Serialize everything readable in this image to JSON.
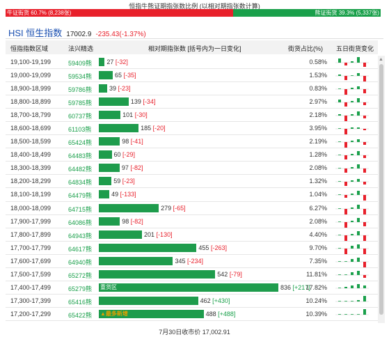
{
  "title": "恒指牛熊证期指张数比例 (以相对期指张数计算)",
  "ratio": {
    "bull_label": "牛证街货 60.7% (8,238张)",
    "bear_label": "熊证街货 39.3% (5,337张)",
    "bull_fraction": 0.607,
    "bull_color": "#e8202b",
    "bear_color": "#1aa04b"
  },
  "hsi": {
    "name": "HSI 恒生指数",
    "value": "17002.9",
    "change": "-235.43(-1.37%)"
  },
  "headers": {
    "range": "恒指指数区域",
    "code": "法兴精选",
    "relative": "相对期指张数 [括号内为一日变化]",
    "pct": "街货占比(%)",
    "five_day": "五日街货变化"
  },
  "colors": {
    "bar": "#1e9c4c",
    "up": "#1aa04b",
    "down": "#e8202b"
  },
  "rows": [
    {
      "range": "19,100-19,199",
      "code": "59409熊",
      "count": "27",
      "delta": "[-32]",
      "pct": "0.58%",
      "bar_value": 27,
      "spark": [
        3,
        -2,
        1,
        4,
        -3
      ]
    },
    {
      "range": "19,000-19,099",
      "code": "59534熊",
      "count": "65",
      "delta": "[-35]",
      "pct": "1.53%",
      "bar_value": 65,
      "spark": [
        1,
        -3,
        0,
        2,
        -4
      ]
    },
    {
      "range": "18,900-18,999",
      "code": "59786熊",
      "count": "39",
      "delta": "[-23]",
      "pct": "0.83%",
      "bar_value": 39,
      "spark": [
        0,
        -4,
        1,
        2,
        -3
      ]
    },
    {
      "range": "18,800-18,899",
      "code": "59785熊",
      "count": "139",
      "delta": "[-34]",
      "pct": "2.97%",
      "bar_value": 139,
      "spark": [
        2,
        -3,
        1,
        3,
        -2
      ]
    },
    {
      "range": "18,700-18,799",
      "code": "60737熊",
      "count": "101",
      "delta": "[-30]",
      "pct": "2.18%",
      "bar_value": 101,
      "spark": [
        1,
        -4,
        1,
        3,
        -2
      ]
    },
    {
      "range": "18,600-18,699",
      "code": "61103熊",
      "count": "185",
      "delta": "[-20]",
      "pct": "3.95%",
      "bar_value": 185,
      "spark": [
        0,
        -4,
        1,
        1,
        -1
      ]
    },
    {
      "range": "18,500-18,599",
      "code": "65424熊",
      "count": "98",
      "delta": "[-41]",
      "pct": "2.19%",
      "bar_value": 98,
      "spark": [
        0,
        -4,
        1,
        2,
        -2
      ]
    },
    {
      "range": "18,400-18,499",
      "code": "64483熊",
      "count": "60",
      "delta": "[-29]",
      "pct": "1.28%",
      "bar_value": 60,
      "spark": [
        0,
        -3,
        1,
        3,
        -2
      ]
    },
    {
      "range": "18,300-18,399",
      "code": "64482熊",
      "count": "97",
      "delta": "[-82]",
      "pct": "2.08%",
      "bar_value": 97,
      "spark": [
        0,
        -3,
        1,
        3,
        -3
      ]
    },
    {
      "range": "18,200-18,299",
      "code": "64834熊",
      "count": "59",
      "delta": "[-23]",
      "pct": "1.32%",
      "bar_value": 59,
      "spark": [
        0,
        -3,
        1,
        2,
        -2
      ]
    },
    {
      "range": "18,100-18,199",
      "code": "64479熊",
      "count": "49",
      "delta": "[-133]",
      "pct": "1.04%",
      "bar_value": 49,
      "spark": [
        0,
        -2,
        1,
        3,
        -4
      ]
    },
    {
      "range": "18,000-18,099",
      "code": "64715熊",
      "count": "279",
      "delta": "[-65]",
      "pct": "6.27%",
      "bar_value": 279,
      "spark": [
        0,
        -4,
        1,
        3,
        -4
      ]
    },
    {
      "range": "17,900-17,999",
      "code": "64086熊",
      "count": "98",
      "delta": "[-82]",
      "pct": "2.08%",
      "bar_value": 98,
      "spark": [
        0,
        -4,
        1,
        3,
        -3
      ]
    },
    {
      "range": "17,800-17,899",
      "code": "64943熊",
      "count": "201",
      "delta": "[-130]",
      "pct": "4.40%",
      "bar_value": 201,
      "spark": [
        0,
        -4,
        1,
        3,
        -4
      ]
    },
    {
      "range": "17,700-17,799",
      "code": "64617熊",
      "count": "455",
      "delta": "[-263]",
      "pct": "9.70%",
      "bar_value": 455,
      "spark": [
        0,
        -4,
        2,
        3,
        -4
      ]
    },
    {
      "range": "17,600-17,699",
      "code": "64940熊",
      "count": "345",
      "delta": "[-234]",
      "pct": "7.35%",
      "bar_value": 345,
      "spark": [
        0,
        0,
        2,
        3,
        -4
      ]
    },
    {
      "range": "17,500-17,599",
      "code": "65272熊",
      "count": "542",
      "delta": "[-79]",
      "pct": "11.81%",
      "bar_value": 542,
      "spark": [
        0,
        0,
        2,
        3,
        -2
      ]
    },
    {
      "range": "17,400-17,499",
      "code": "65279熊",
      "count": "836",
      "delta": "[+217]",
      "pct": "17.82%",
      "bar_value": 836,
      "bar_note": "重货区",
      "spark": [
        0,
        1,
        2,
        3,
        2
      ]
    },
    {
      "range": "17,300-17,399",
      "code": "65416熊",
      "count": "462",
      "delta": "[+430]",
      "pct": "10.24%",
      "bar_value": 462,
      "spark": [
        0,
        0,
        0,
        1,
        4
      ]
    },
    {
      "range": "17,200-17,299",
      "code": "65422熊",
      "count": "488",
      "delta": "[+488]",
      "pct": "10.39%",
      "bar_value": 488,
      "bar_note": "▲最多新增",
      "spark": [
        0,
        0,
        0,
        0,
        4
      ]
    }
  ],
  "footer": "7月30日收市价 17,002.91"
}
